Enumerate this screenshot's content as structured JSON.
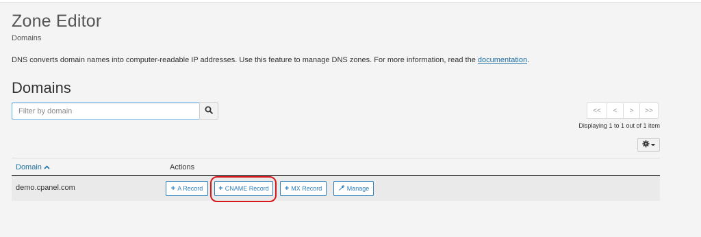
{
  "page": {
    "title": "Zone Editor",
    "breadcrumb": "Domains",
    "intro_text": "DNS converts domain names into computer-readable IP addresses. Use this feature to manage DNS zones. For more information, read the ",
    "intro_link": "documentation",
    "intro_end": "."
  },
  "section": {
    "title": "Domains"
  },
  "search": {
    "placeholder": "Filter by domain",
    "value": "",
    "button_icon": "search-icon"
  },
  "pagination": {
    "first": "<<",
    "prev": "<",
    "next": ">",
    "last": ">>",
    "status": "Displaying 1 to 1 out of 1 item"
  },
  "settings": {
    "icon": "gear-icon"
  },
  "table": {
    "columns": [
      {
        "label": "Domain",
        "sorted": "asc"
      },
      {
        "label": "Actions"
      }
    ],
    "rows": [
      {
        "domain": "demo.cpanel.com",
        "actions": [
          {
            "label": "A Record",
            "icon": "plus-icon"
          },
          {
            "label": "CNAME Record",
            "icon": "plus-icon"
          },
          {
            "label": "MX Record",
            "icon": "plus-icon"
          },
          {
            "label": "Manage",
            "icon": "wrench-icon"
          }
        ]
      }
    ]
  },
  "colors": {
    "link": "#1d6fa5",
    "button_border": "#2e7fbc",
    "highlight": "#d9161c",
    "row_background": "#eaeaea"
  }
}
